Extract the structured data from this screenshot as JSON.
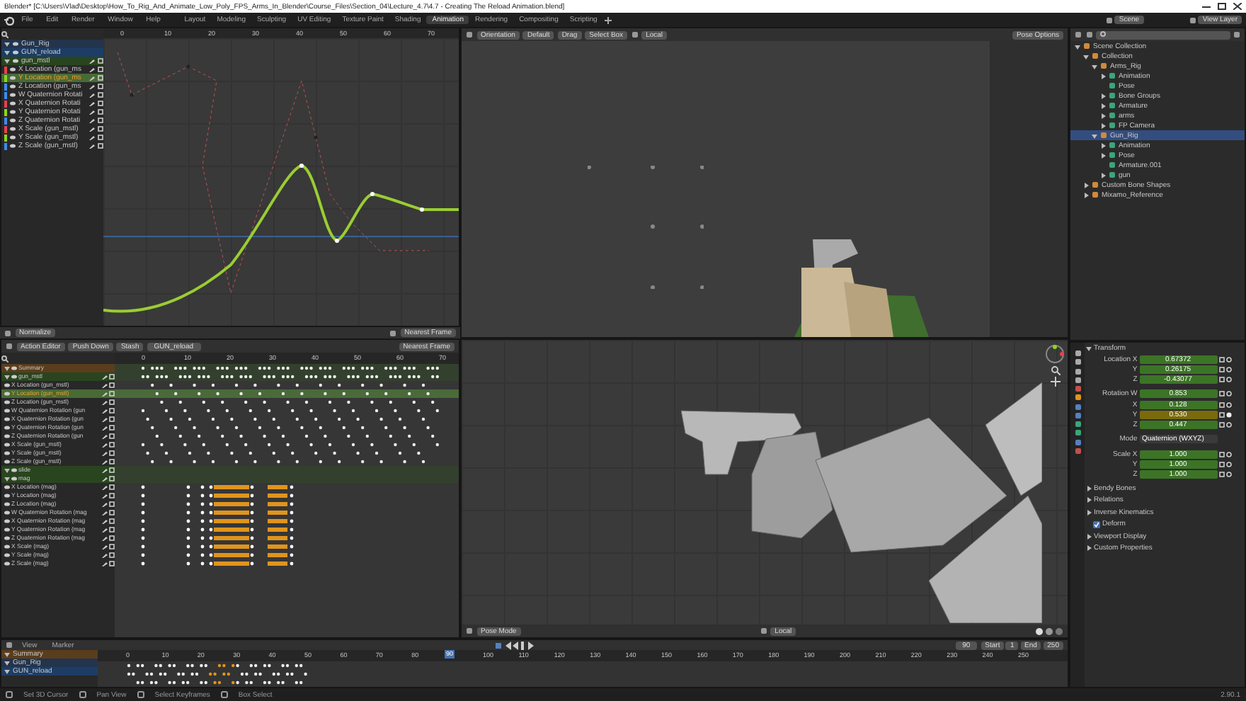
{
  "window": {
    "title": "Blender* [C:\\Users\\Vlad\\Desktop\\How_To_Rig_And_Animate_Low_Poly_FPS_Arms_In_Blender\\Course_Files\\Section_04\\Lecture_4.7\\4.7 - Creating The Reload Animation.blend]"
  },
  "menu": [
    "File",
    "Edit",
    "Render",
    "Window",
    "Help"
  ],
  "workspace_tabs": [
    {
      "label": "Layout",
      "selected": false
    },
    {
      "label": "Modeling",
      "selected": false
    },
    {
      "label": "Sculpting",
      "selected": false
    },
    {
      "label": "UV Editing",
      "selected": false
    },
    {
      "label": "Texture Paint",
      "selected": false
    },
    {
      "label": "Shading",
      "selected": false
    },
    {
      "label": "Animation",
      "selected": true
    },
    {
      "label": "Rendering",
      "selected": false
    },
    {
      "label": "Compositing",
      "selected": false
    },
    {
      "label": "Scripting",
      "selected": false
    }
  ],
  "scene": "Scene",
  "view_layer": "View Layer",
  "graph_editor": {
    "frames": [
      "0",
      "10",
      "20",
      "30",
      "40",
      "50",
      "60",
      "70"
    ],
    "channels": [
      {
        "label": "Gun_Rig",
        "kind": "object",
        "selected": false
      },
      {
        "label": "GUN_reload",
        "kind": "action",
        "selected": false
      },
      {
        "label": "gun_mstl",
        "kind": "group",
        "selected": false
      },
      {
        "label": "X Location (gun_ms",
        "kind": "curve",
        "color": "#e8404f",
        "selected": false
      },
      {
        "label": "Y Location (gun_ms",
        "kind": "curve",
        "color": "#8cd61c",
        "selected": true
      },
      {
        "label": "Z Location (gun_ms",
        "kind": "curve",
        "color": "#3b8cf0",
        "selected": false
      },
      {
        "label": "W Quaternion Rotati",
        "kind": "curve",
        "color": "#3b8cf0",
        "selected": false
      },
      {
        "label": "X Quaternion Rotati",
        "kind": "curve",
        "color": "#e8404f",
        "selected": false
      },
      {
        "label": "Y Quaternion Rotati",
        "kind": "curve",
        "color": "#8cd61c",
        "selected": false
      },
      {
        "label": "Z Quaternion Rotati",
        "kind": "curve",
        "color": "#3b8cf0",
        "selected": false
      },
      {
        "label": "X Scale (gun_mstl)",
        "kind": "curve",
        "color": "#e8404f",
        "selected": false
      },
      {
        "label": "Y Scale (gun_mstl)",
        "kind": "curve",
        "color": "#8cd61c",
        "selected": false
      },
      {
        "label": "Z Scale (gun_mstl)",
        "kind": "curve",
        "color": "#3b8cf0",
        "selected": false
      }
    ],
    "footer": {
      "normalize": "Normalize",
      "snap": "Nearest Frame"
    }
  },
  "camera_view": {
    "header": [
      "Orientation",
      "Default",
      "Drag",
      "Select Box",
      "Local",
      "Pose Options"
    ]
  },
  "dope_sheet": {
    "mode": "Action Editor",
    "buttons": [
      "Push Down",
      "Stash"
    ],
    "action": "GUN_reload",
    "snap": "Nearest Frame",
    "frames": [
      "0",
      "10",
      "20",
      "30",
      "40",
      "50",
      "60",
      "70"
    ],
    "channels": [
      {
        "label": "Summary",
        "kind": "summary",
        "selected": false
      },
      {
        "label": "gun_mstl",
        "kind": "group",
        "selected": false
      },
      {
        "label": "X Location (gun_mstl)",
        "kind": "channel",
        "selected": false
      },
      {
        "label": "Y Location (gun_mstl)",
        "kind": "channel",
        "selected": true
      },
      {
        "label": "Z Location (gun_mstl)",
        "kind": "channel",
        "selected": false
      },
      {
        "label": "W Quaternion Rotation (gun",
        "kind": "channel",
        "selected": false
      },
      {
        "label": "X Quaternion Rotation (gun",
        "kind": "channel",
        "selected": false
      },
      {
        "label": "Y Quaternion Rotation (gun",
        "kind": "channel",
        "selected": false
      },
      {
        "label": "Z Quaternion Rotation (gun",
        "kind": "channel",
        "selected": false
      },
      {
        "label": "X Scale (gun_mstl)",
        "kind": "channel",
        "selected": false
      },
      {
        "label": "Y Scale (gun_mstl)",
        "kind": "channel",
        "selected": false
      },
      {
        "label": "Z Scale (gun_mstl)",
        "kind": "channel",
        "selected": false
      },
      {
        "label": "slide",
        "kind": "group",
        "selected": false
      },
      {
        "label": "mag",
        "kind": "group",
        "selected": false
      },
      {
        "label": "X Location (mag)",
        "kind": "mag",
        "selected": false
      },
      {
        "label": "Y Location (mag)",
        "kind": "mag",
        "selected": false
      },
      {
        "label": "Z Location (mag)",
        "kind": "mag",
        "selected": false
      },
      {
        "label": "W Quaternion Rotation (mag",
        "kind": "mag",
        "selected": false
      },
      {
        "label": "X Quaternion Rotation (mag",
        "kind": "mag",
        "selected": false
      },
      {
        "label": "Y Quaternion Rotation (mag",
        "kind": "mag",
        "selected": false
      },
      {
        "label": "Z Quaternion Rotation (mag",
        "kind": "mag",
        "selected": false
      },
      {
        "label": "X Scale (mag)",
        "kind": "mag",
        "selected": false
      },
      {
        "label": "Y Scale (mag)",
        "kind": "mag",
        "selected": false
      },
      {
        "label": "Z Scale (mag)",
        "kind": "mag",
        "selected": false
      }
    ]
  },
  "viewport": {
    "mode": "Pose Mode",
    "pivot": "Local"
  },
  "timeline": {
    "menu": [
      "View",
      "Marker"
    ],
    "current_frame": "90",
    "current_frame_marker": "90",
    "start_label": "Start",
    "start": "1",
    "end_label": "End",
    "end": "250",
    "frames": [
      "0",
      "10",
      "20",
      "30",
      "40",
      "50",
      "60",
      "70",
      "80",
      "100",
      "110",
      "120",
      "130",
      "140",
      "150",
      "160",
      "170",
      "180",
      "190",
      "200",
      "210",
      "220",
      "230",
      "240",
      "250"
    ],
    "channels": [
      {
        "label": "Summary",
        "kind": "summary"
      },
      {
        "label": "Gun_Rig",
        "kind": "object"
      },
      {
        "label": "GUN_reload",
        "kind": "action"
      }
    ]
  },
  "outliner": {
    "items": [
      {
        "label": "Scene Collection",
        "expanded": true,
        "selected": false,
        "children": [
          {
            "label": "Collection",
            "expanded": true,
            "selected": false,
            "children": [
              {
                "label": "Arms_Rig",
                "expanded": true,
                "selected": false,
                "children": [
                  {
                    "label": "Animation",
                    "expanded": false,
                    "selected": false
                  },
                  {
                    "label": "Pose",
                    "selected": false
                  },
                  {
                    "label": "Bone Groups",
                    "expanded": false,
                    "selected": false
                  },
                  {
                    "label": "Armature",
                    "expanded": false,
                    "selected": false
                  },
                  {
                    "label": "arms",
                    "expanded": false,
                    "selected": false
                  },
                  {
                    "label": "FP Camera",
                    "expanded": false,
                    "selected": false
                  }
                ]
              },
              {
                "label": "Gun_Rig",
                "expanded": true,
                "selected": true,
                "children": [
                  {
                    "label": "Animation",
                    "expanded": false,
                    "selected": false
                  },
                  {
                    "label": "Pose",
                    "expanded": false,
                    "selected": false
                  },
                  {
                    "label": "Armature.001",
                    "selected": false
                  },
                  {
                    "label": "gun",
                    "expanded": false,
                    "selected": false
                  }
                ]
              }
            ]
          },
          {
            "label": "Custom Bone Shapes",
            "expanded": false,
            "selected": false
          },
          {
            "label": "Mixamo_Reference",
            "expanded": false,
            "selected": false
          }
        ]
      }
    ]
  },
  "properties": {
    "section": "Transform",
    "fields": [
      {
        "label": "Location X",
        "value": "0.67372",
        "kind": "keyed"
      },
      {
        "label": "Y",
        "value": "0.26175",
        "kind": "keyed"
      },
      {
        "label": "Z",
        "value": "-0.43077",
        "kind": "keyed"
      },
      {
        "label": "Rotation W",
        "value": "0.853",
        "kind": "keyed"
      },
      {
        "label": "X",
        "value": "0.128",
        "kind": "keyed"
      },
      {
        "label": "Y",
        "value": "0.530",
        "kind": "changed"
      },
      {
        "label": "Z",
        "value": "0.447",
        "kind": "keyed"
      },
      {
        "label": "Mode",
        "value": "Quaternion (WXYZ)",
        "kind": "dropdown"
      },
      {
        "label": "Scale X",
        "value": "1.000",
        "kind": "keyed"
      },
      {
        "label": "Y",
        "value": "1.000",
        "kind": "keyed"
      },
      {
        "label": "Z",
        "value": "1.000",
        "kind": "keyed"
      }
    ],
    "panels": [
      {
        "label": "Bendy Bones",
        "kind": "panel"
      },
      {
        "label": "Relations",
        "kind": "panel"
      },
      {
        "label": "Inverse Kinematics",
        "kind": "panel"
      },
      {
        "label": "Deform",
        "kind": "checkbox",
        "checked": true
      },
      {
        "label": "Viewport Display",
        "kind": "panel"
      },
      {
        "label": "Custom Properties",
        "kind": "panel"
      }
    ]
  },
  "status_bar": [
    "Set 3D Cursor",
    "Pan View",
    "Select Keyframes",
    "Box Select",
    "2.90.1"
  ]
}
